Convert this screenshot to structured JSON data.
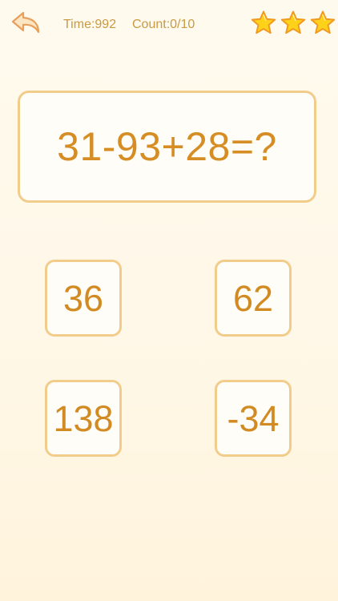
{
  "header": {
    "time_label": "Time:992",
    "count_label": "Count:0/10",
    "stars": [
      {
        "icon": "star-icon",
        "filled": true
      },
      {
        "icon": "star-icon",
        "filled": true
      },
      {
        "icon": "star-icon",
        "filled": true
      }
    ]
  },
  "question": {
    "expression": "31-93+28=?"
  },
  "answers": [
    {
      "label": "36"
    },
    {
      "label": "62"
    },
    {
      "label": "138"
    },
    {
      "label": "-34"
    }
  ],
  "colors": {
    "accent": "#d68d24",
    "border": "#f1cd8b",
    "background": "#fffaee",
    "star_fill": "#ffd21a",
    "star_stroke": "#f19a22"
  }
}
